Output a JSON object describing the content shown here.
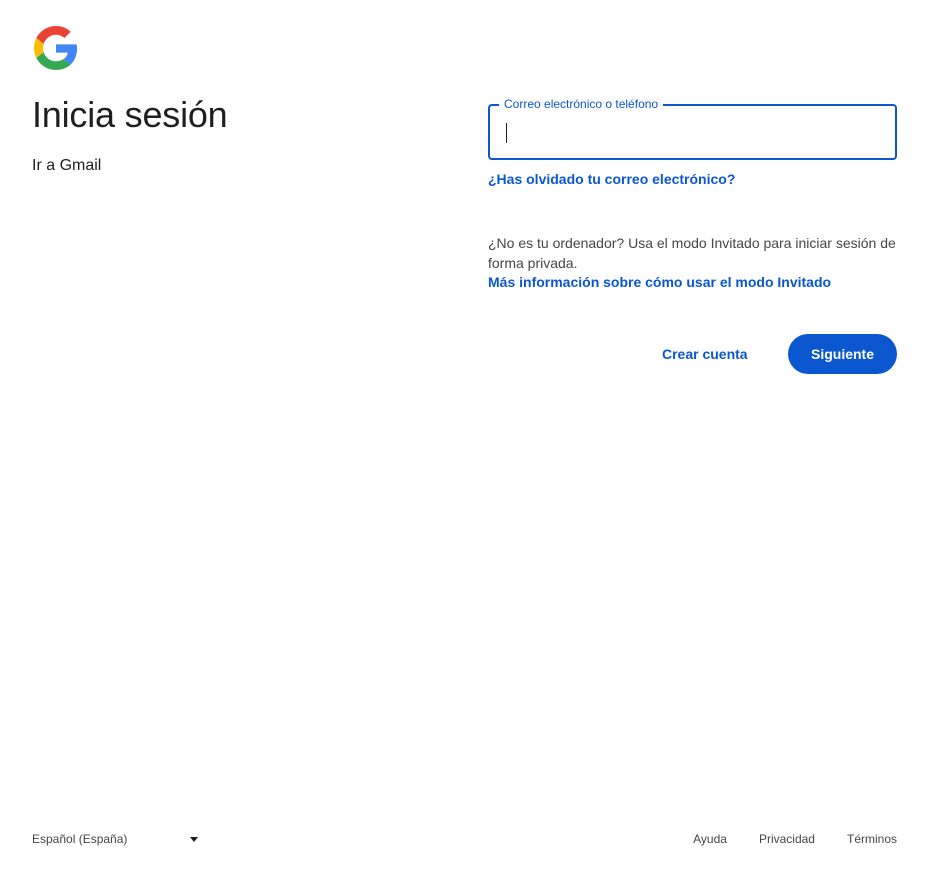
{
  "header": {
    "logo_icon": "google-g-logo",
    "title": "Inicia sesión",
    "subtitle": "Ir a Gmail"
  },
  "form": {
    "field_label": "Correo electrónico o teléfono",
    "field_value": "",
    "forgot_link": "¿Has olvidado tu correo electrónico?",
    "guest_text": "¿No es tu ordenador? Usa el modo Invitado para iniciar sesión de forma privada.",
    "guest_link": "Más información sobre cómo usar el modo Invitado",
    "create_label": "Crear cuenta",
    "next_label": "Siguiente"
  },
  "footer": {
    "language": "Español (España)",
    "help": "Ayuda",
    "privacy": "Privacidad",
    "terms": "Términos"
  },
  "colors": {
    "accent": "#0b57d0",
    "text": "#1f1f1f",
    "muted": "#444746",
    "google_blue": "#4285F4",
    "google_red": "#EA4335",
    "google_yellow": "#FBBC05",
    "google_green": "#34A853"
  }
}
